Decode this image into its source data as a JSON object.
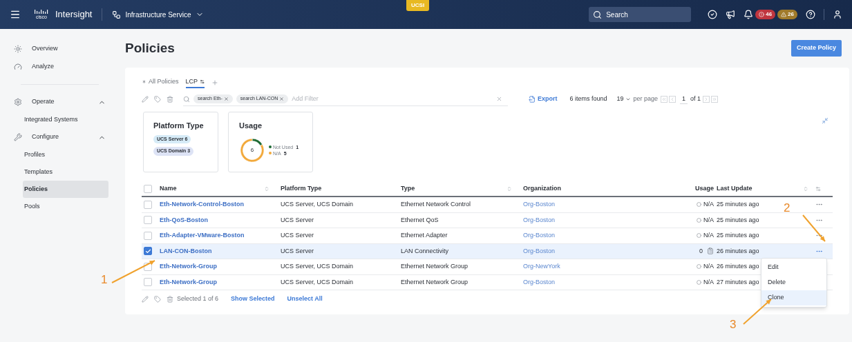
{
  "top_bar": {
    "brand": "cisco",
    "product": "Intersight",
    "service": "Infrastructure Service",
    "context_tab": "UCSI",
    "search": {
      "placeholder": "Search"
    },
    "alerts": [
      {
        "kind": "critical",
        "count": "46"
      },
      {
        "kind": "warning",
        "count": "26"
      }
    ]
  },
  "sidebar": {
    "items": [
      {
        "label": "Overview",
        "selected": false
      },
      {
        "label": "Analyze",
        "selected": false
      },
      {
        "label": "Operate",
        "expanded": true,
        "selected": false,
        "children": [
          {
            "label": "Integrated Systems",
            "selected": false
          }
        ]
      },
      {
        "label": "Configure",
        "expanded": true,
        "selected": false,
        "children": [
          {
            "label": "Profiles",
            "selected": false
          },
          {
            "label": "Templates",
            "selected": false
          },
          {
            "label": "Policies",
            "selected": true
          },
          {
            "label": "Pools",
            "selected": false
          }
        ]
      }
    ]
  },
  "page": {
    "title": "Policies",
    "primary_button": "Create Policy"
  },
  "tabs": [
    {
      "label": "All Policies",
      "kind": "default",
      "selected": false
    },
    {
      "label": "LCP",
      "kind": "custom",
      "selected": true
    }
  ],
  "filter_bar": {
    "filters": [
      "search Eth-",
      "search LAN-CON"
    ],
    "placeholder": "Add Filter",
    "export": "Export",
    "found": "6 items found",
    "per_page": "19",
    "per_page_label": "per page",
    "page": "1",
    "of": "of 1"
  },
  "summary": {
    "platform": {
      "title": "Platform Type",
      "tags": [
        {
          "label": "UCS Server 6",
          "color": "#d6ebf7"
        },
        {
          "label": "UCS Domain 3",
          "color": "#dde3f5"
        }
      ]
    },
    "usage": {
      "title": "Usage",
      "total": "6",
      "legend": [
        {
          "count": "1",
          "color": "#1d6a33"
        },
        {
          "count": "5",
          "color": "#f2a93b"
        }
      ],
      "chart_data": {
        "type": "donut",
        "categories": [
          "Not Used",
          "N/A"
        ],
        "values": [
          16.67,
          83.33
        ]
      }
    }
  },
  "table": {
    "select_all_checked": false,
    "columns": [
      "Name",
      "Platform Type",
      "Type",
      "Organization",
      "Usage",
      "Last Update"
    ],
    "rows": [
      {
        "checked": false,
        "name": "Eth-Network-Control-Boston",
        "platform": "UCS Server, UCS Domain",
        "type": "Ethernet Network Control",
        "organization": "Org-Boston",
        "usage": {
          "kind": "na",
          "text": "N/A"
        },
        "updated": "25 minutes ago"
      },
      {
        "checked": false,
        "name": "Eth-QoS-Boston",
        "platform": "UCS Server",
        "type": "Ethernet QoS",
        "organization": "Org-Boston",
        "usage": {
          "kind": "na",
          "text": "N/A"
        },
        "updated": "25 minutes ago"
      },
      {
        "checked": false,
        "name": "Eth-Adapter-VMware-Boston",
        "platform": "UCS Server",
        "type": "Ethernet Adapter",
        "organization": "Org-Boston",
        "usage": {
          "kind": "na",
          "text": "N/A"
        },
        "updated": "25 minutes ago"
      },
      {
        "checked": true,
        "menu_open": true,
        "name": "LAN-CON-Boston",
        "platform": "UCS Server",
        "type": "LAN Connectivity",
        "organization": "Org-Boston",
        "usage": {
          "kind": "count",
          "text": "0"
        },
        "updated": "26 minutes ago"
      },
      {
        "checked": false,
        "name": "Eth-Network-Group",
        "platform": "UCS Server, UCS Domain",
        "type": "Ethernet Network Group",
        "organization": "Org-NewYork",
        "usage": {
          "kind": "na",
          "text": "N/A"
        },
        "updated": "26 minutes ago"
      },
      {
        "checked": false,
        "name": "Eth-Network-Group",
        "platform": "UCS Server, UCS Domain",
        "type": "Ethernet Network Group",
        "organization": "Org-Boston",
        "usage": {
          "kind": "na",
          "text": "N/A"
        },
        "updated": "27 minutes ago"
      }
    ],
    "footer": {
      "selected": "Selected 1 of 6",
      "show_selected": "Show Selected",
      "unselect_all": "Unselect All"
    }
  },
  "row_menu": {
    "items": [
      {
        "label": "Edit",
        "selected": false
      },
      {
        "label": "Delete",
        "selected": false
      },
      {
        "label": "Clone",
        "selected": true
      }
    ]
  },
  "annotations": [
    {
      "label": "1"
    },
    {
      "label": "2"
    },
    {
      "label": "3"
    }
  ]
}
